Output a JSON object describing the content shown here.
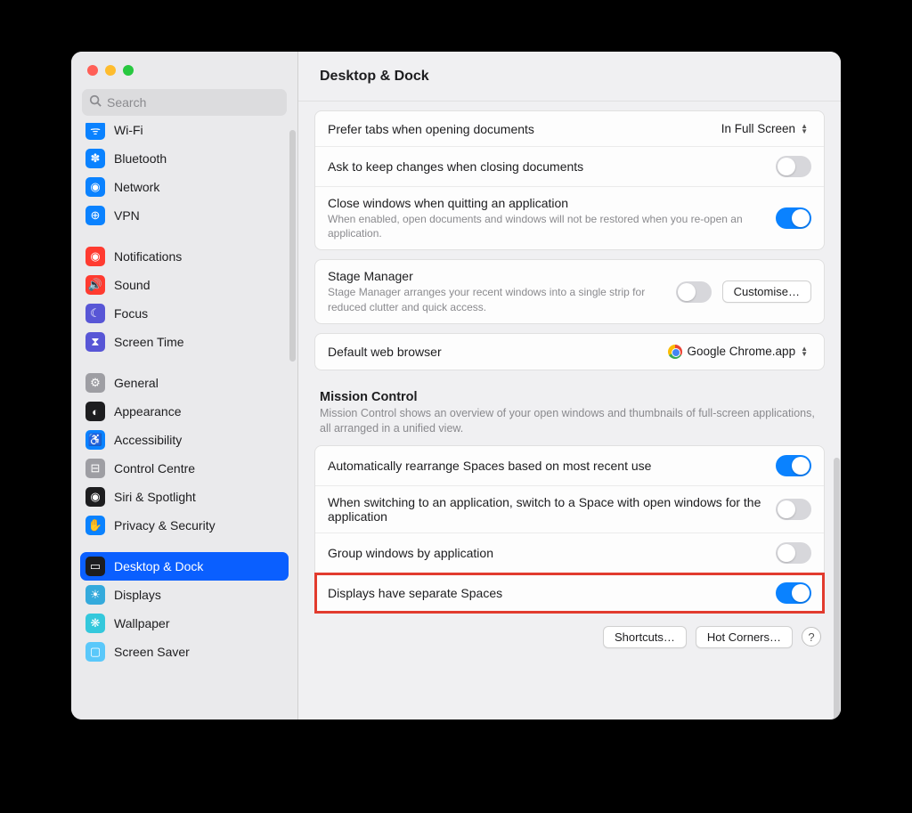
{
  "header": {
    "title": "Desktop & Dock"
  },
  "search": {
    "placeholder": "Search"
  },
  "sidebar": {
    "items": [
      {
        "label": "Wi-Fi",
        "icon": "wifi",
        "color": "#0a82ff"
      },
      {
        "label": "Bluetooth",
        "icon": "bluetooth",
        "color": "#0a82ff"
      },
      {
        "label": "Network",
        "icon": "network",
        "color": "#0a82ff"
      },
      {
        "label": "VPN",
        "icon": "vpn",
        "color": "#0a82ff"
      },
      {
        "gap": true
      },
      {
        "label": "Notifications",
        "icon": "notifications",
        "color": "#ff3b30"
      },
      {
        "label": "Sound",
        "icon": "sound",
        "color": "#ff3b30"
      },
      {
        "label": "Focus",
        "icon": "focus",
        "color": "#5856d6"
      },
      {
        "label": "Screen Time",
        "icon": "screentime",
        "color": "#5856d6"
      },
      {
        "gap": true
      },
      {
        "label": "General",
        "icon": "general",
        "color": "#9e9ea3"
      },
      {
        "label": "Appearance",
        "icon": "appearance",
        "color": "#1d1d1f"
      },
      {
        "label": "Accessibility",
        "icon": "accessibility",
        "color": "#0a82ff"
      },
      {
        "label": "Control Centre",
        "icon": "controlcentre",
        "color": "#9e9ea3"
      },
      {
        "label": "Siri & Spotlight",
        "icon": "siri",
        "color": "#1d1d1f"
      },
      {
        "label": "Privacy & Security",
        "icon": "privacy",
        "color": "#0a82ff"
      },
      {
        "gap": true
      },
      {
        "label": "Desktop & Dock",
        "icon": "desktopdock",
        "color": "#1d1d1f",
        "selected": true
      },
      {
        "label": "Displays",
        "icon": "displays",
        "color": "#34aadc"
      },
      {
        "label": "Wallpaper",
        "icon": "wallpaper",
        "color": "#34c8dc"
      },
      {
        "label": "Screen Saver",
        "icon": "screensaver",
        "color": "#5ac8fa"
      }
    ]
  },
  "settings": {
    "preferTabs": {
      "label": "Prefer tabs when opening documents",
      "value": "In Full Screen"
    },
    "askKeep": {
      "label": "Ask to keep changes when closing documents",
      "on": false
    },
    "closeWindows": {
      "label": "Close windows when quitting an application",
      "sub": "When enabled, open documents and windows will not be restored when you re-open an application.",
      "on": true
    },
    "stageManager": {
      "label": "Stage Manager",
      "sub": "Stage Manager arranges your recent windows into a single strip for reduced clutter and quick access.",
      "on": false,
      "button": "Customise…"
    },
    "defaultBrowser": {
      "label": "Default web browser",
      "value": "Google Chrome.app"
    },
    "missionControl": {
      "title": "Mission Control",
      "desc": "Mission Control shows an overview of your open windows and thumbnails of full-screen applications, all arranged in a unified view."
    },
    "autoRearrange": {
      "label": "Automatically rearrange Spaces based on most recent use",
      "on": true
    },
    "switchSpace": {
      "label": "When switching to an application, switch to a Space with open windows for the application",
      "on": false
    },
    "groupWindows": {
      "label": "Group windows by application",
      "on": false
    },
    "separateSpaces": {
      "label": "Displays have separate Spaces",
      "on": true
    },
    "footer": {
      "shortcuts": "Shortcuts…",
      "hotCorners": "Hot Corners…"
    }
  }
}
